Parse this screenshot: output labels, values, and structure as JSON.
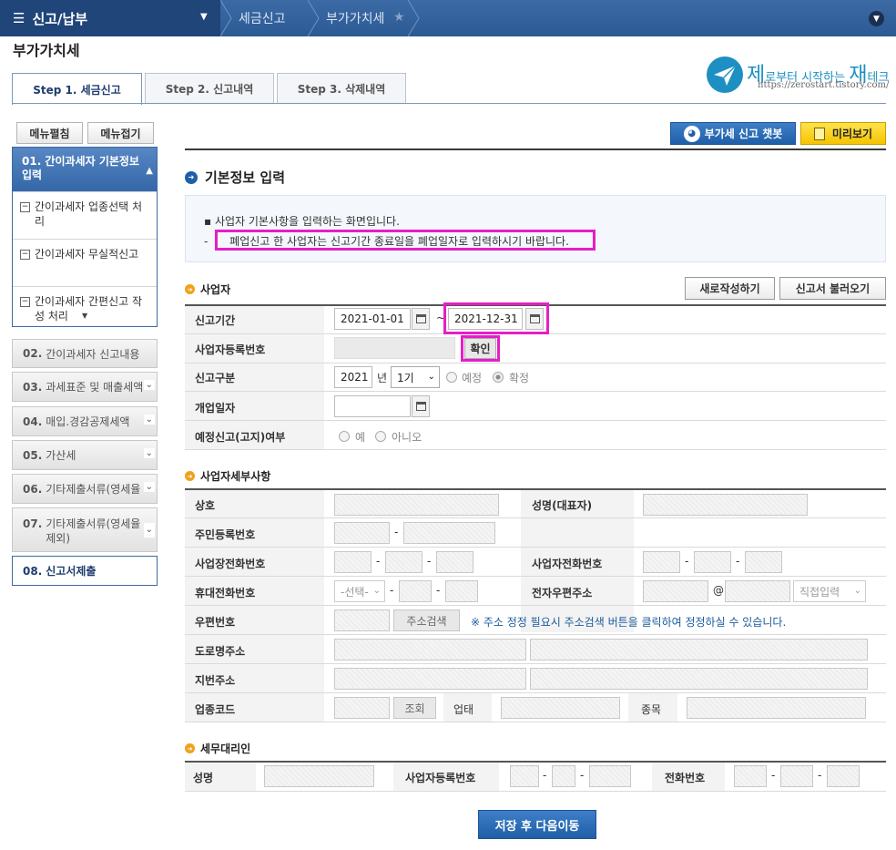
{
  "nav": {
    "main": "신고/납부",
    "crumbs": [
      "세금신고",
      "부가가치세"
    ]
  },
  "page_title": "부가가치세",
  "logo": {
    "prefix": "제",
    "text1": "로부터 시작하는 ",
    "big": "재",
    "text2": "테크",
    "url": "https://zerostart.tistory.com/"
  },
  "tabs": [
    "Step 1. 세금신고",
    "Step 2. 신고내역",
    "Step 3. 삭제내역"
  ],
  "menu": {
    "expand": "메뉴펼침",
    "collapse": "메뉴접기",
    "active": "01. 간이과세자 기본정보 입력",
    "subs": [
      "간이과세자 업종선택 처리",
      "간이과세자 무실적신고",
      "간이과세자 간편신고 작성 처리"
    ],
    "items": [
      {
        "num": "02.",
        "label": "간이과세자 신고내용"
      },
      {
        "num": "03.",
        "label": "과세표준 및 매출세액"
      },
      {
        "num": "04.",
        "label": "매입.경감공제세액"
      },
      {
        "num": "05.",
        "label": "가산세"
      },
      {
        "num": "06.",
        "label": "기타제출서류(영세율"
      },
      {
        "num": "07.",
        "label": "기타제출서류(영세율",
        "label2": "제외)"
      },
      {
        "num": "08.",
        "label": "신고서제출"
      }
    ]
  },
  "buttons": {
    "chatbot": "부가세 신고 챗봇",
    "preview": "미리보기",
    "new": "새로작성하기",
    "load": "신고서 불러오기",
    "confirm": "확인",
    "address_search": "주소검색",
    "lookup": "조회",
    "save": "저장 후 다음이동"
  },
  "section_title": "기본정보 입력",
  "info": [
    "사업자 기본사항을 입력하는 화면입니다.",
    "폐업신고 한 사업자는 신고기간 종료일을 폐업일자로 입력하시기 바랍니다."
  ],
  "business": {
    "heading": "사업자",
    "labels": {
      "period": "신고기간",
      "reg_no": "사업자등록번호",
      "type": "신고구분",
      "open_date": "개업일자",
      "prelim": "예정신고(고지)여부"
    },
    "period_start": "2021-01-01",
    "tilde": "~",
    "period_end": "2021-12-31",
    "year": "2021",
    "year_unit": "년",
    "term": "1기",
    "radio_prelim": "예정",
    "radio_final": "확정",
    "radio_yes": "예",
    "radio_no": "아니오"
  },
  "detail": {
    "heading": "사업자세부사항",
    "labels": {
      "company": "상호",
      "ceo": "성명(대표자)",
      "resident": "주민등록번호",
      "biz_phone": "사업장전화번호",
      "biz_tel": "사업자전화번호",
      "mobile": "휴대전화번호",
      "email": "전자우편주소",
      "zip": "우편번호",
      "road": "도로명주소",
      "lot": "지번주소",
      "industry": "업종코드",
      "biz_type": "업태",
      "item": "종목"
    },
    "mobile_select": "-선택-",
    "email_at": "@",
    "email_domain": "직접입력",
    "zip_note": "※ 주소 정정 필요시 주소검색 버튼을 클릭하여 정정하실 수 있습니다."
  },
  "agent": {
    "heading": "세무대리인",
    "labels": {
      "name": "성명",
      "reg_no": "사업자등록번호",
      "phone": "전화번호"
    }
  },
  "dash": "-"
}
